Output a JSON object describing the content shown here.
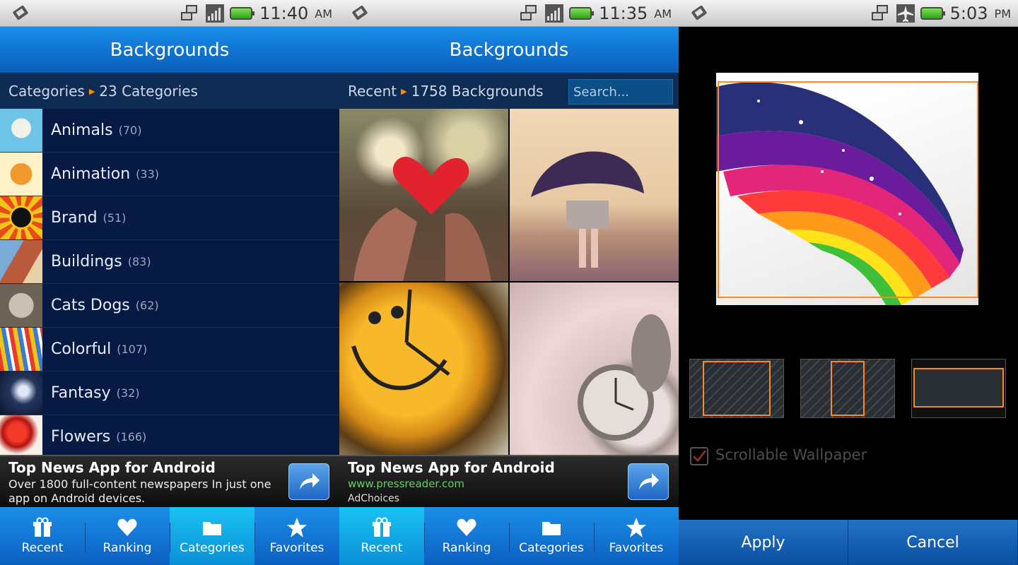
{
  "screens": [
    {
      "status": {
        "time": "11:40",
        "ampm": "AM"
      },
      "title": "Backgrounds",
      "crumb": {
        "section": "Categories",
        "detail": "23 Categories"
      },
      "categories": [
        {
          "name": "Animals",
          "count": "(70)"
        },
        {
          "name": "Animation",
          "count": "(33)"
        },
        {
          "name": "Brand",
          "count": "(51)"
        },
        {
          "name": "Buildings",
          "count": "(83)"
        },
        {
          "name": "Cats Dogs",
          "count": "(62)"
        },
        {
          "name": "Colorful",
          "count": "(107)"
        },
        {
          "name": "Fantasy",
          "count": "(32)"
        },
        {
          "name": "Flowers",
          "count": "(166)"
        }
      ],
      "ad": {
        "title": "Top News App for Android",
        "text": "Over 1800 full-content newspapers In just one app on Android devices."
      },
      "tabs": [
        {
          "label": "Recent",
          "icon": "gift-icon"
        },
        {
          "label": "Ranking",
          "icon": "heart-icon"
        },
        {
          "label": "Categories",
          "icon": "folder-icon"
        },
        {
          "label": "Favorites",
          "icon": "star-icon"
        }
      ],
      "active_tab": "Categories"
    },
    {
      "status": {
        "time": "11:35",
        "ampm": "AM"
      },
      "title": "Backgrounds",
      "crumb": {
        "section": "Recent",
        "detail": "1758 Backgrounds"
      },
      "search_placeholder": "Search...",
      "ad": {
        "title": "Top News App for Android",
        "url": "www.pressreader.com",
        "choices": "AdChoices"
      },
      "tabs": [
        {
          "label": "Recent",
          "icon": "gift-icon"
        },
        {
          "label": "Ranking",
          "icon": "heart-icon"
        },
        {
          "label": "Categories",
          "icon": "folder-icon"
        },
        {
          "label": "Favorites",
          "icon": "star-icon"
        }
      ],
      "active_tab": "Recent"
    },
    {
      "status": {
        "time": "5:03",
        "ampm": "PM"
      },
      "checkbox_label": "Scrollable Wallpaper",
      "apply_label": "Apply",
      "cancel_label": "Cancel"
    }
  ],
  "colors": {
    "accent_orange": "#ff8a1c",
    "titlebar_blue": "#1074d4",
    "list_bg": "#061a44"
  }
}
